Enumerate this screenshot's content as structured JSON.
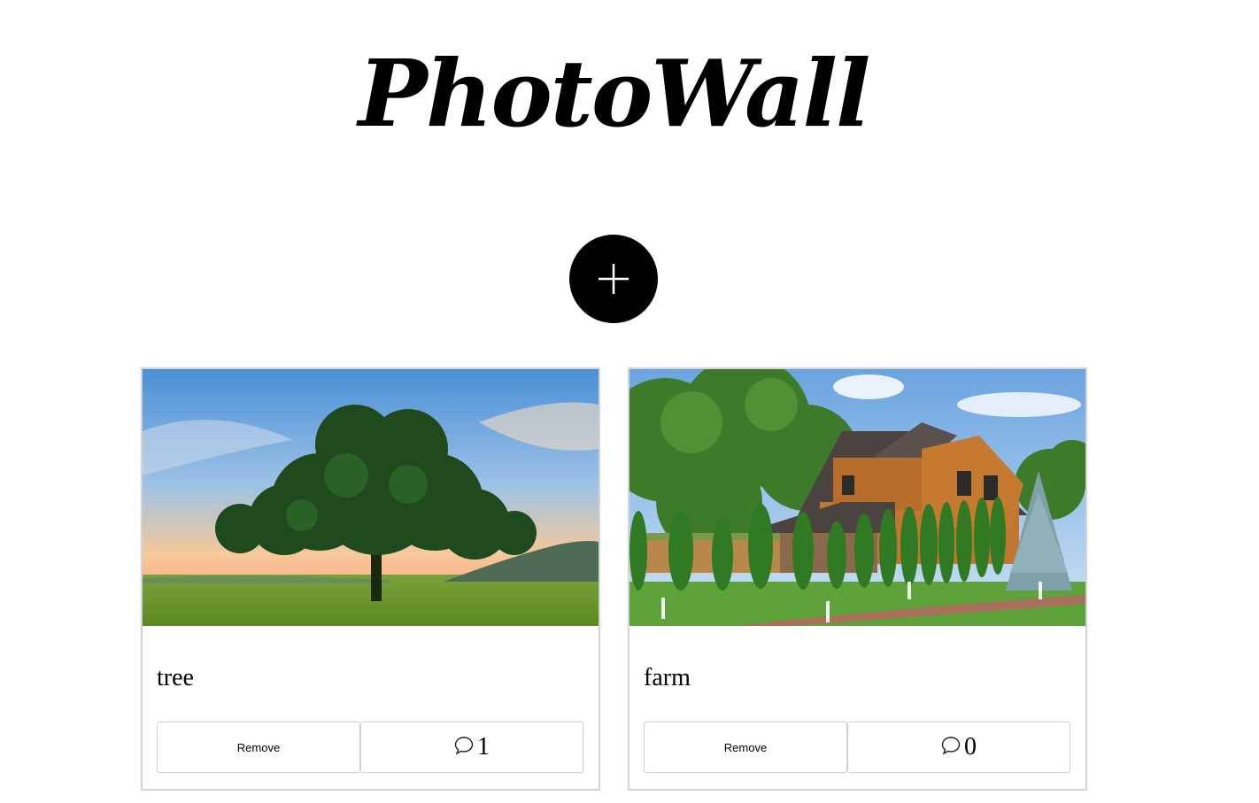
{
  "header": {
    "title": "PhotoWall"
  },
  "toolbar": {
    "add_icon": "plus-icon"
  },
  "posts": [
    {
      "caption": "tree",
      "remove_label": "Remove",
      "comment_count": "1",
      "image_subject": "tree-at-sunset-photo"
    },
    {
      "caption": "farm",
      "remove_label": "Remove",
      "comment_count": "0",
      "image_subject": "wooden-house-garden-photo"
    }
  ],
  "colors": {
    "accent": "#000000",
    "card_border": "#d4d4d4",
    "button_border": "#cfcfcf"
  }
}
